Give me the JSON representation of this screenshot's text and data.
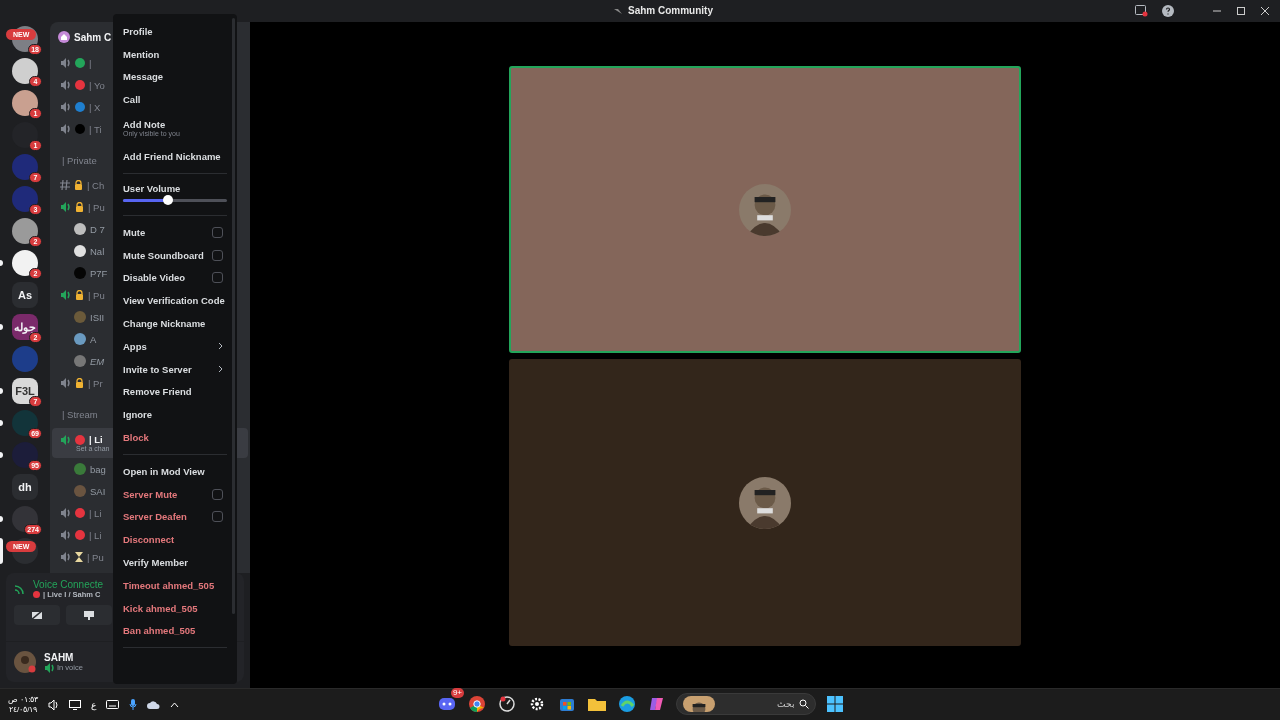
{
  "title_bar": {
    "title": "Sahm Community"
  },
  "servers": [
    {
      "kind": "avatar",
      "color": "#7d7f85",
      "badge": "18",
      "pill": "NEW",
      "unread": false,
      "selected": false
    },
    {
      "kind": "avatar",
      "color": "#cfcfcf",
      "badge": "4",
      "unread": false,
      "selected": false
    },
    {
      "kind": "avatar",
      "color": "#c9a090",
      "badge": "1",
      "unread": false,
      "selected": false
    },
    {
      "kind": "avatar",
      "color": "#232428",
      "badge": "1",
      "unread": false,
      "selected": false
    },
    {
      "kind": "avatar",
      "color": "#1f2a7a",
      "badge": "7",
      "unread": false,
      "selected": false
    },
    {
      "kind": "avatar",
      "color": "#1f2a7a",
      "badge": "3",
      "unread": false,
      "selected": false
    },
    {
      "kind": "avatar",
      "color": "#9a9a9a",
      "badge": "2",
      "unread": false,
      "selected": false
    },
    {
      "kind": "avatar",
      "color": "#f2f2f2",
      "badge": "2",
      "unread": true,
      "selected": false
    },
    {
      "kind": "text",
      "label": "As",
      "unread": false,
      "selected": false
    },
    {
      "kind": "text",
      "label": "جوله",
      "color": "#7a2a6a",
      "badge": "2",
      "unread": true,
      "selected": false
    },
    {
      "kind": "avatar",
      "color": "#1d3d8a",
      "unread": false,
      "selected": false
    },
    {
      "kind": "text",
      "label": "F3L",
      "color": "#d9d9d9",
      "badge": "7",
      "unread": true,
      "selected": false
    },
    {
      "kind": "avatar",
      "color": "#12343a",
      "badge": "69",
      "unread": true,
      "selected": false
    },
    {
      "kind": "avatar",
      "color": "#1c1d3a",
      "badge": "95",
      "unread": true,
      "selected": false
    },
    {
      "kind": "text",
      "label": "dh",
      "unread": false,
      "selected": false
    },
    {
      "kind": "avatar",
      "color": "#333338",
      "badge": "274",
      "unread": true,
      "selected": false
    },
    {
      "kind": "avatar",
      "color": "#2b2d31",
      "pill": "NEW",
      "unread": false,
      "selected": true
    }
  ],
  "channels": [
    {
      "kind": "header",
      "label": "Sahm C"
    },
    {
      "kind": "voice",
      "label": "|",
      "color": "#23a55a",
      "active": false,
      "locked": false
    },
    {
      "kind": "voice",
      "label": "| Yo",
      "color": "#e5343f",
      "active": false,
      "locked": false
    },
    {
      "kind": "voice",
      "label": "| X",
      "color": "#1f7fcf",
      "active": false,
      "locked": false
    },
    {
      "kind": "voice",
      "label": "| Ti",
      "color": "#000000",
      "active": false,
      "locked": false
    },
    {
      "kind": "category",
      "label": "| Private"
    },
    {
      "kind": "text",
      "label": "| Ch",
      "locked": true
    },
    {
      "kind": "voice",
      "label": "| Pu",
      "active": true,
      "locked": true
    },
    {
      "kind": "member",
      "label": "D 7",
      "color": "#bdbdbd"
    },
    {
      "kind": "member",
      "label": "Nal",
      "color": "#e0e0e0"
    },
    {
      "kind": "member",
      "label": "P7F",
      "color": "#050505"
    },
    {
      "kind": "voice",
      "label": "| Pu",
      "active": true,
      "locked": true
    },
    {
      "kind": "member",
      "label": "ISII",
      "color": "#6b5a3a",
      "italic": false
    },
    {
      "kind": "member",
      "label": "A",
      "color": "#6a9ac0",
      "italic": false
    },
    {
      "kind": "member",
      "label": "EM",
      "color": "#777777",
      "italic": true
    },
    {
      "kind": "voice",
      "label": "| Pr",
      "active": false,
      "locked": true
    },
    {
      "kind": "category",
      "label": "| Stream"
    },
    {
      "kind": "voice",
      "label": "| Li",
      "color": "#e5343f",
      "active": true,
      "locked": false,
      "sub": "Set a chan"
    },
    {
      "kind": "member",
      "label": "bag",
      "color": "#3a7a3a",
      "italic": false
    },
    {
      "kind": "member",
      "label": "SAI",
      "color": "#6a5440",
      "italic": false
    },
    {
      "kind": "voice",
      "label": "| Li",
      "color": "#e5343f",
      "active": false,
      "locked": false
    },
    {
      "kind": "voice",
      "label": "| Li",
      "color": "#e5343f",
      "active": false,
      "locked": false
    },
    {
      "kind": "waiting",
      "label": "| Pu"
    }
  ],
  "voice_panel": {
    "status": "Voice Connecte",
    "channel": "| Live I / Sahm C"
  },
  "user_panel": {
    "name": "SAHM",
    "status": "In voice"
  },
  "menu": {
    "items": [
      {
        "kind": "item",
        "label": "Profile",
        "danger": false
      },
      {
        "kind": "item",
        "label": "Mention",
        "danger": false
      },
      {
        "kind": "item",
        "label": "Message",
        "danger": false
      },
      {
        "kind": "item",
        "label": "Call",
        "danger": false
      },
      {
        "kind": "item",
        "label": "Add Note",
        "sublabel": "Only visible to you",
        "danger": false
      },
      {
        "kind": "item",
        "label": "Add Friend Nickname",
        "danger": false
      },
      {
        "kind": "separator"
      },
      {
        "kind": "slider",
        "label": "User Volume",
        "level": 0.43
      },
      {
        "kind": "separator"
      },
      {
        "kind": "checkbox",
        "label": "Mute",
        "checked": false,
        "danger": false
      },
      {
        "kind": "checkbox",
        "label": "Mute Soundboard",
        "checked": false,
        "danger": false
      },
      {
        "kind": "checkbox",
        "label": "Disable Video",
        "checked": false,
        "danger": false
      },
      {
        "kind": "item",
        "label": "View Verification Code",
        "danger": false
      },
      {
        "kind": "item",
        "label": "Change Nickname",
        "danger": false
      },
      {
        "kind": "submenu",
        "label": "Apps",
        "danger": false
      },
      {
        "kind": "submenu",
        "label": "Invite to Server",
        "danger": false
      },
      {
        "kind": "item",
        "label": "Remove Friend",
        "danger": false
      },
      {
        "kind": "item",
        "label": "Ignore",
        "danger": false
      },
      {
        "kind": "item",
        "label": "Block",
        "danger": true
      },
      {
        "kind": "separator"
      },
      {
        "kind": "item",
        "label": "Open in Mod View",
        "danger": false
      },
      {
        "kind": "checkbox",
        "label": "Server Mute",
        "checked": false,
        "danger": true
      },
      {
        "kind": "checkbox",
        "label": "Server Deafen",
        "checked": false,
        "danger": true
      },
      {
        "kind": "item",
        "label": "Disconnect",
        "danger": true
      },
      {
        "kind": "item",
        "label": "Verify Member",
        "danger": false
      },
      {
        "kind": "item",
        "label": "Timeout ahmed_505",
        "danger": true
      },
      {
        "kind": "item",
        "label": "Kick ahmed_505",
        "danger": true
      },
      {
        "kind": "item",
        "label": "Ban ahmed_505",
        "danger": true
      },
      {
        "kind": "separator"
      }
    ]
  },
  "video_tiles": [
    {
      "color": "#84665a",
      "speaking": true
    },
    {
      "color": "#33261b",
      "speaking": false
    }
  ],
  "taskbar": {
    "time": "٠١:٥٣ ص",
    "date": "٢٤/٠٥/١٩",
    "language": "ع",
    "discord_badge": "9+",
    "search_placeholder": "بحث"
  }
}
